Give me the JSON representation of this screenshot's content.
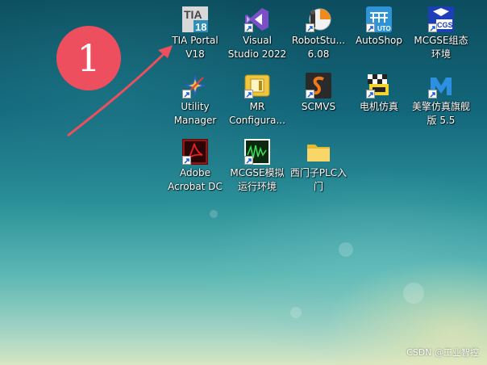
{
  "desktop": {
    "icons": [
      {
        "label": "TIA Portal\nV18",
        "icon": "tia-portal-icon"
      },
      {
        "label": "Visual\nStudio 2022",
        "icon": "visual-studio-icon"
      },
      {
        "label": "RobotStu...\n6.08",
        "icon": "robotstudio-icon"
      },
      {
        "label": "AutoShop",
        "icon": "autoshop-icon"
      },
      {
        "label": "MCGSE组态\n环境",
        "icon": "mcgse-icon"
      },
      {
        "label": "Utility\nManager",
        "icon": "utility-manager-icon"
      },
      {
        "label": "MR\nConfigura...",
        "icon": "mr-configurator-icon"
      },
      {
        "label": "SCMVS",
        "icon": "scmvs-icon"
      },
      {
        "label": "电机仿真",
        "icon": "motor-sim-icon"
      },
      {
        "label": "美擎仿真旗舰\n版 5.5",
        "icon": "meiqing-sim-icon"
      },
      {
        "label": "Adobe\nAcrobat DC",
        "icon": "acrobat-icon"
      },
      {
        "label": "MCGSE模拟\n运行环境",
        "icon": "mcgse-sim-icon"
      },
      {
        "label": "西门子PLC入\n门",
        "icon": "folder-icon"
      }
    ]
  },
  "annotation": {
    "badge_text": "1",
    "badge_color": "#ee4f5e"
  },
  "watermark": "CSDN @工业智控"
}
